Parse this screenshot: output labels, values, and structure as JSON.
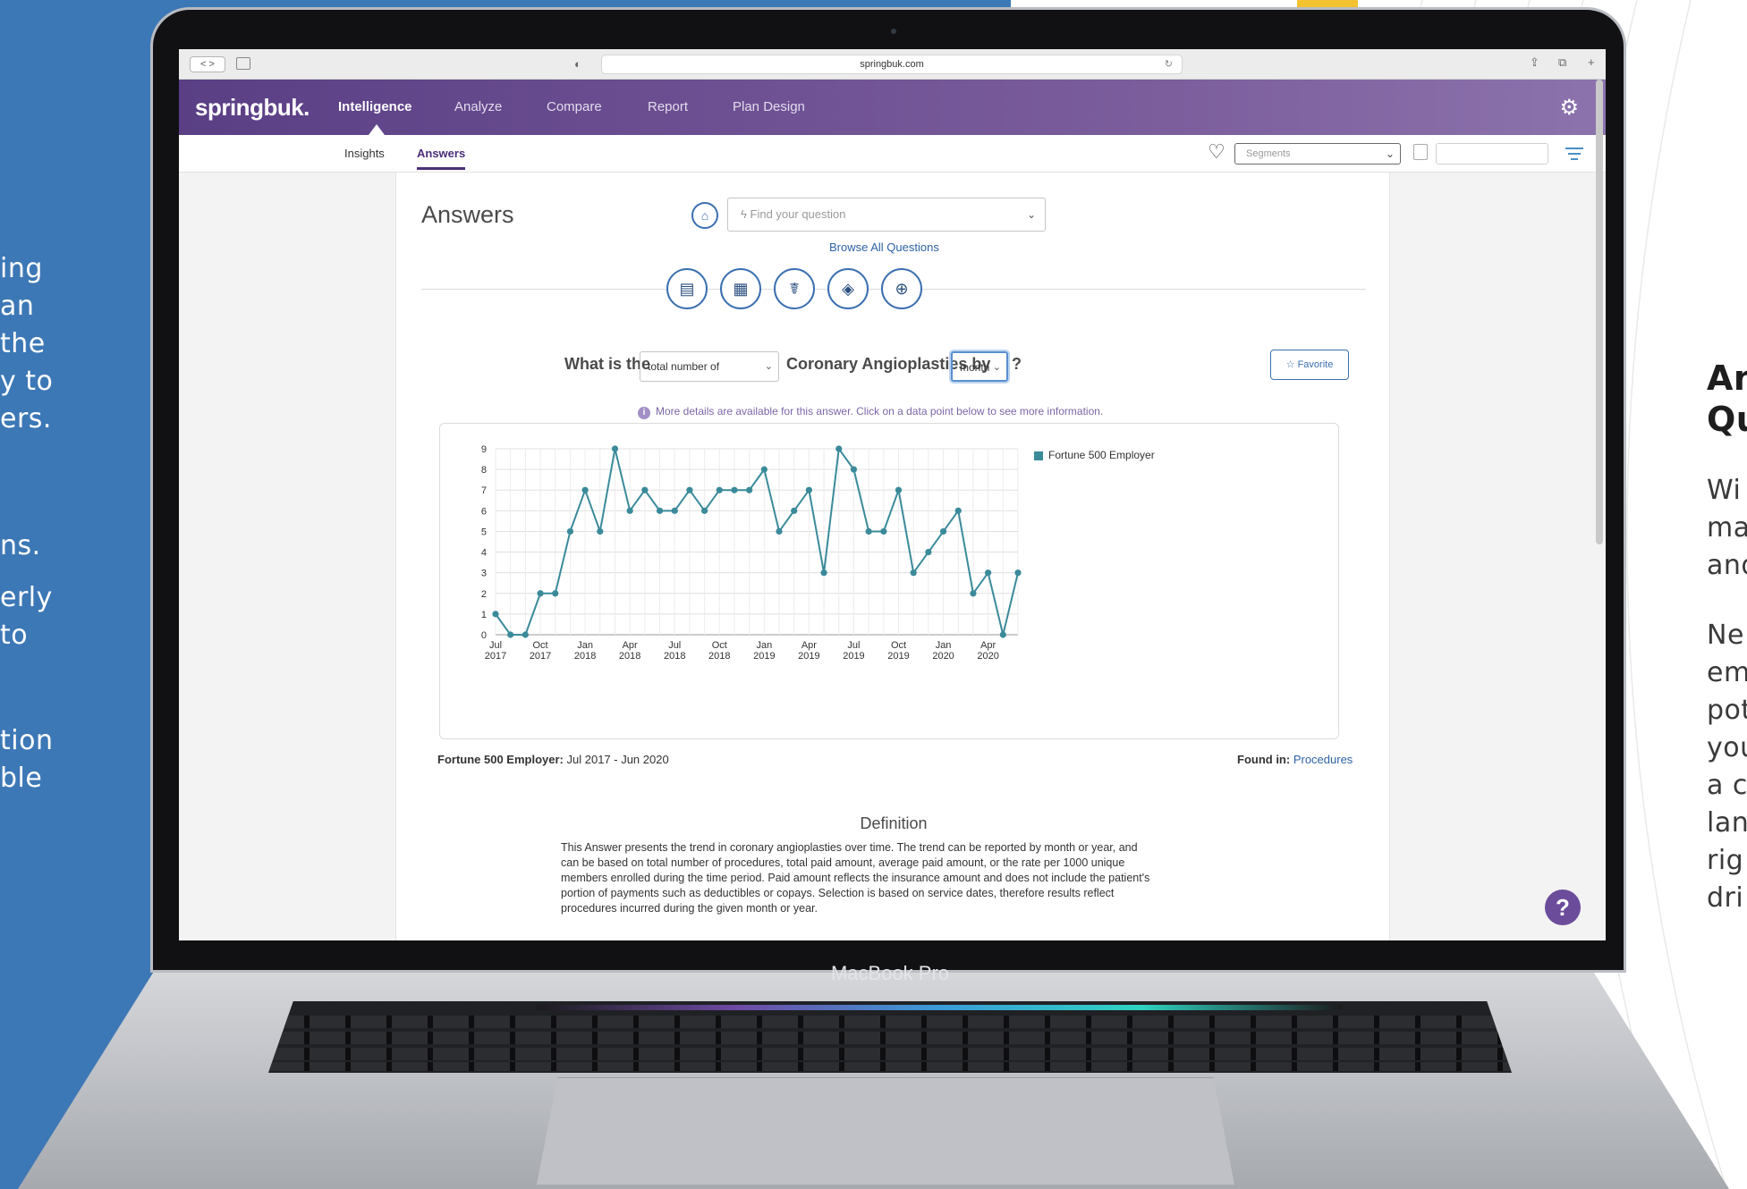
{
  "left_text": [
    "ing",
    "an",
    "the",
    "y to",
    "ers.",
    "ns.",
    "erly",
    "to",
    "tion",
    "ble"
  ],
  "right_text": {
    "heading": [
      "An",
      "Qu"
    ],
    "para1": [
      "Wi",
      "ma",
      "and"
    ],
    "para2": [
      "Ne",
      "em",
      "pot",
      "you",
      "a c",
      "lan",
      "rig",
      "dri"
    ]
  },
  "device": {
    "label": "MacBook Pro"
  },
  "browser": {
    "url": "springbuk.com",
    "nav_arrows": "< >"
  },
  "app": {
    "logo": "springbuk.",
    "nav": [
      "Intelligence",
      "Analyze",
      "Compare",
      "Report",
      "Plan Design"
    ],
    "active_nav": "Intelligence",
    "subnav": [
      "Insights",
      "Answers"
    ],
    "active_subnav": "Answers",
    "segments_placeholder": "Segments"
  },
  "page": {
    "title": "Answers",
    "search_placeholder": "Find your question",
    "search_bolt": "ϟ",
    "browse_link": "Browse All Questions",
    "categories": [
      "financial-report-icon",
      "monitor-report-icon",
      "stethoscope-icon",
      "pill-icon",
      "clipboard-add-icon"
    ],
    "question": {
      "prefix": "What is the",
      "measure": "total number of",
      "subject": "Coronary Angioplasties by",
      "period": "month",
      "suffix": "?"
    },
    "favorite_label": "☆ Favorite",
    "info_note": "More details are available for this answer. Click on a data point below to see more information.",
    "range_label_bold": "Fortune 500 Employer:",
    "range_label_value": "Jul 2017 - Jun 2020",
    "found_in_label": "Found in:",
    "found_in_link": "Procedures",
    "definition_title": "Definition",
    "definition_body": "This Answer presents the trend in coronary angioplasties over time. The trend can be reported by month or year, and can be based on total number of procedures, total paid amount, average paid amount, or the rate per 1000 unique members enrolled during the time period. Paid amount reflects the insurance amount and does not include the patient's portion of payments such as deductibles or copays. Selection is based on service dates, therefore results reflect procedures incurred during the given month or year.",
    "help_label": "?"
  },
  "chart_data": {
    "type": "line",
    "title": "",
    "xlabel": "",
    "ylabel": "",
    "ylim": [
      0,
      9
    ],
    "grid": true,
    "legend": "top-right",
    "x": [
      "Jul 2017",
      "Aug 2017",
      "Sep 2017",
      "Oct 2017",
      "Nov 2017",
      "Dec 2017",
      "Jan 2018",
      "Feb 2018",
      "Mar 2018",
      "Apr 2018",
      "May 2018",
      "Jun 2018",
      "Jul 2018",
      "Aug 2018",
      "Sep 2018",
      "Oct 2018",
      "Nov 2018",
      "Dec 2018",
      "Jan 2019",
      "Feb 2019",
      "Mar 2019",
      "Apr 2019",
      "May 2019",
      "Jun 2019",
      "Jul 2019",
      "Aug 2019",
      "Sep 2019",
      "Oct 2019",
      "Nov 2019",
      "Dec 2019",
      "Jan 2020",
      "Feb 2020",
      "Mar 2020",
      "Apr 2020",
      "May 2020",
      "Jun 2020"
    ],
    "x_tick_labels": [
      [
        "Jul",
        "2017"
      ],
      [
        "Oct",
        "2017"
      ],
      [
        "Jan",
        "2018"
      ],
      [
        "Apr",
        "2018"
      ],
      [
        "Jul",
        "2018"
      ],
      [
        "Oct",
        "2018"
      ],
      [
        "Jan",
        "2019"
      ],
      [
        "Apr",
        "2019"
      ],
      [
        "Jul",
        "2019"
      ],
      [
        "Oct",
        "2019"
      ],
      [
        "Jan",
        "2020"
      ],
      [
        "Apr",
        "2020"
      ]
    ],
    "y_ticks": [
      0,
      1,
      2,
      3,
      4,
      5,
      6,
      7,
      8,
      9
    ],
    "series": [
      {
        "name": "Fortune 500 Employer",
        "color": "#3a8a9a",
        "values": [
          1,
          0,
          0,
          2,
          2,
          5,
          7,
          5,
          9,
          6,
          7,
          6,
          6,
          7,
          6,
          7,
          7,
          7,
          8,
          5,
          6,
          7,
          3,
          9,
          8,
          5,
          5,
          7,
          3,
          4,
          5,
          6,
          2,
          3,
          0,
          3
        ]
      }
    ]
  }
}
